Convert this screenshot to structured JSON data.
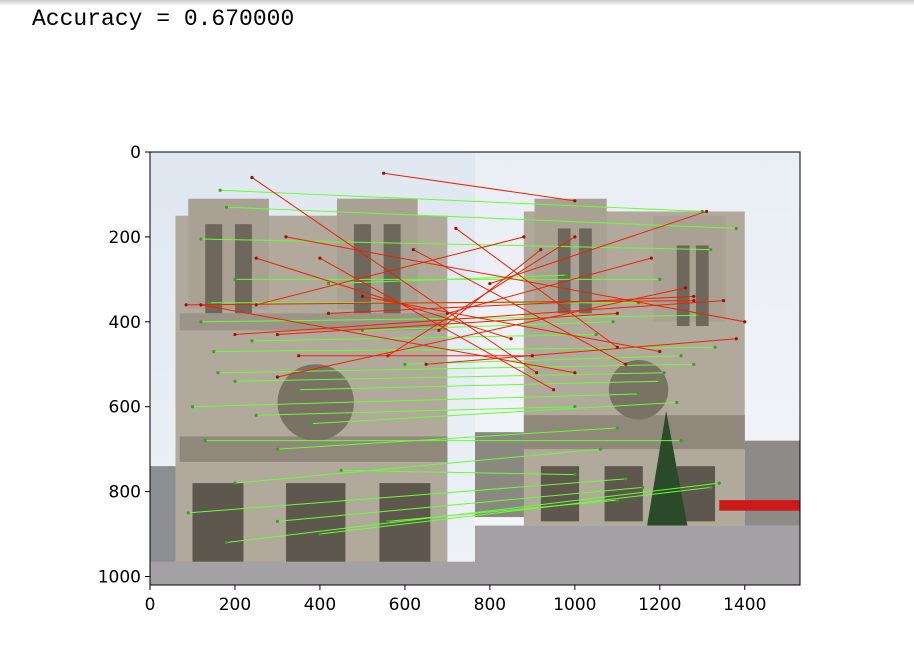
{
  "output": {
    "accuracy_text": "Accuracy = 0.670000"
  },
  "chart_data": {
    "type": "image-matches",
    "title": "",
    "xlabel": "",
    "ylabel": "",
    "xlim": [
      0,
      1530
    ],
    "ylim": [
      1020,
      0
    ],
    "y_inverted": true,
    "grid": false,
    "image_split_x": 765,
    "colors": {
      "correct": "#66ff33",
      "incorrect": "#ee2200",
      "sky_left": "#e4ecf4",
      "sky_right": "#f0f3f8",
      "stone": "#b1aa9c",
      "stone_dark": "#6e675b",
      "plaza": "#a3a1a3",
      "tree": "#2a4a2a",
      "crane": "#cc1a1a"
    },
    "xticks": [
      0,
      200,
      400,
      600,
      800,
      1000,
      1200,
      1400
    ],
    "yticks": [
      0,
      200,
      400,
      600,
      800,
      1000
    ],
    "correct_matches": [
      [
        165,
        90,
        1300,
        140
      ],
      [
        120,
        205,
        1320,
        230
      ],
      [
        200,
        300,
        1200,
        300
      ],
      [
        140,
        355,
        1150,
        355
      ],
      [
        120,
        400,
        1290,
        385
      ],
      [
        150,
        470,
        1330,
        460
      ],
      [
        200,
        540,
        1210,
        520
      ],
      [
        100,
        600,
        1150,
        570
      ],
      [
        130,
        680,
        1250,
        680
      ],
      [
        200,
        780,
        1060,
        700
      ],
      [
        90,
        850,
        1120,
        770
      ],
      [
        180,
        920,
        1340,
        780
      ],
      [
        300,
        870,
        1160,
        790
      ],
      [
        400,
        900,
        1320,
        790
      ],
      [
        500,
        420,
        1090,
        400
      ],
      [
        420,
        310,
        980,
        290
      ],
      [
        180,
        130,
        1380,
        180
      ],
      [
        250,
        620,
        1000,
        600
      ],
      [
        300,
        700,
        1100,
        650
      ],
      [
        350,
        560,
        1200,
        540
      ],
      [
        600,
        500,
        1250,
        480
      ],
      [
        450,
        750,
        1000,
        760
      ],
      [
        560,
        870,
        1100,
        820
      ],
      [
        240,
        445,
        1050,
        430
      ],
      [
        380,
        640,
        1240,
        590
      ],
      [
        160,
        520,
        1280,
        500
      ]
    ],
    "incorrect_matches": [
      [
        550,
        50,
        1000,
        115
      ],
      [
        240,
        60,
        910,
        520
      ],
      [
        85,
        360,
        1280,
        350
      ],
      [
        320,
        200,
        1400,
        400
      ],
      [
        620,
        230,
        1120,
        500
      ],
      [
        420,
        380,
        1280,
        340
      ],
      [
        250,
        360,
        880,
        200
      ],
      [
        800,
        310,
        1310,
        140
      ],
      [
        560,
        480,
        1000,
        200
      ],
      [
        120,
        360,
        1000,
        520
      ],
      [
        300,
        430,
        1100,
        380
      ],
      [
        700,
        380,
        1180,
        250
      ],
      [
        200,
        430,
        1350,
        350
      ],
      [
        650,
        500,
        1380,
        440
      ],
      [
        400,
        250,
        950,
        560
      ],
      [
        350,
        480,
        900,
        480
      ],
      [
        500,
        340,
        1200,
        470
      ],
      [
        250,
        250,
        850,
        440
      ],
      [
        680,
        420,
        920,
        230
      ],
      [
        720,
        180,
        1100,
        460
      ],
      [
        300,
        530,
        1260,
        320
      ]
    ]
  }
}
